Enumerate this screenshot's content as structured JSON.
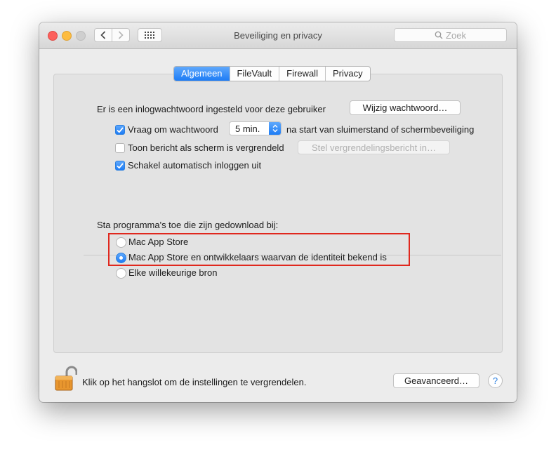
{
  "window": {
    "title": "Beveiliging en privacy"
  },
  "search": {
    "placeholder": "Zoek"
  },
  "tabs": [
    {
      "label": "Algemeen",
      "active": true
    },
    {
      "label": "FileVault",
      "active": false
    },
    {
      "label": "Firewall",
      "active": false
    },
    {
      "label": "Privacy",
      "active": false
    }
  ],
  "login": {
    "password_text": "Er is een inlogwachtwoord ingesteld voor deze gebruiker",
    "change_password_label": "Wijzig wachtwoord…",
    "require_password": {
      "label": "Vraag om wachtwoord",
      "checked": true
    },
    "delay_value": "5 min.",
    "delay_suffix": "na start van sluimerstand of schermbeveiliging",
    "show_message": {
      "label": "Toon bericht als scherm is vergrendeld",
      "checked": false
    },
    "set_message_label": "Stel vergrendelingsbericht in…",
    "disable_autologin": {
      "label": "Schakel automatisch inloggen uit",
      "checked": true
    }
  },
  "downloads": {
    "heading": "Sta programma's toe die zijn gedownload bij:",
    "options": [
      {
        "label": "Mac App Store",
        "selected": false
      },
      {
        "label": "Mac App Store en ontwikkelaars waarvan de identiteit bekend is",
        "selected": true
      },
      {
        "label": "Elke willekeurige bron",
        "selected": false
      }
    ]
  },
  "footer": {
    "lock_text": "Klik op het hangslot om de instellingen te vergrendelen.",
    "advanced_label": "Geavanceerd…",
    "help_label": "?"
  },
  "colors": {
    "accent": "#1d7cf5",
    "highlight": "#e0281e"
  }
}
